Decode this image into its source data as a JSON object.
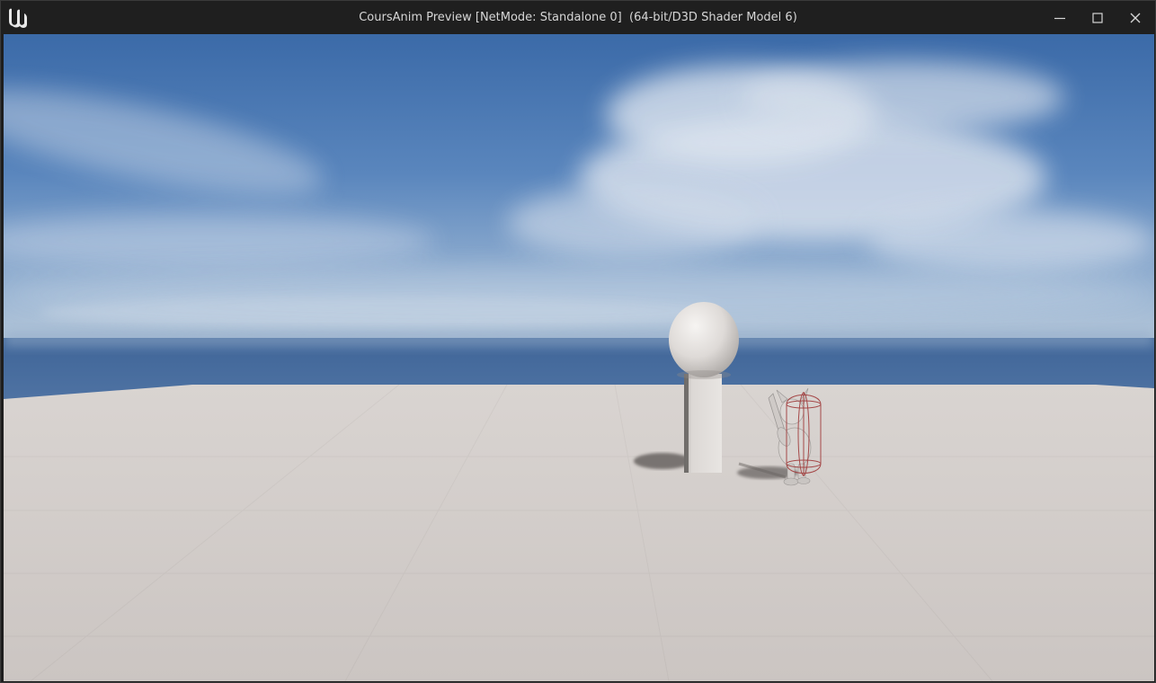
{
  "window": {
    "title": "CoursAnim Preview [NetMode: Standalone 0]  (64-bit/D3D Shader Model 6)",
    "logo_icon": "unreal-engine-logo-icon",
    "controls": {
      "minimize_icon": "minimize-icon",
      "maximize_icon": "maximize-icon",
      "close_icon": "close-icon"
    }
  },
  "viewport": {
    "scene": "3d-game-preview",
    "objects": [
      "sky",
      "ocean",
      "floor",
      "sphere",
      "pillar",
      "character"
    ]
  },
  "colors": {
    "titlebar": "#1f1f1f",
    "title_text": "#d6d6d6",
    "sky_top": "#3f6fae",
    "sky_horizon": "#8fb0d4",
    "ocean": "#4a6d9c",
    "floor": "#d2cdca",
    "debug_capsule": "#a03a3a"
  }
}
